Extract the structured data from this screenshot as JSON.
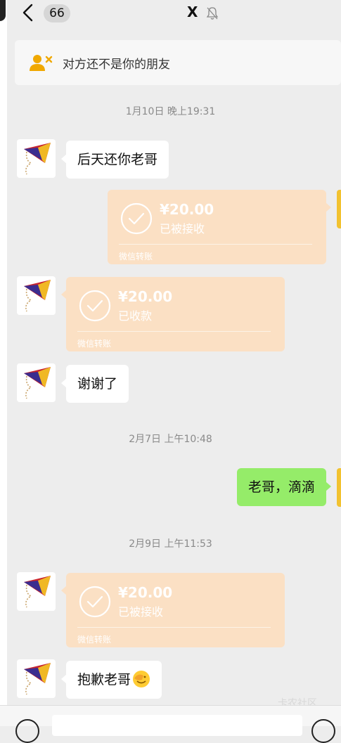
{
  "header": {
    "back_count": "66",
    "title": "X"
  },
  "notice": {
    "text": "对方还不是你的朋友"
  },
  "messages": [
    {
      "kind": "time",
      "text": "1月10日 晚上19:31"
    },
    {
      "kind": "text",
      "side": "left",
      "text": "后天还你老哥"
    },
    {
      "kind": "transfer",
      "side": "right",
      "amount": "¥20.00",
      "status": "已被接收",
      "footer": "微信转账"
    },
    {
      "kind": "transfer",
      "side": "left",
      "amount": "¥20.00",
      "status": "已收款",
      "footer": "微信转账"
    },
    {
      "kind": "text",
      "side": "left",
      "text": "谢谢了"
    },
    {
      "kind": "time",
      "text": "2月7日 上午10:48"
    },
    {
      "kind": "text",
      "side": "right",
      "text": "老哥，滴滴"
    },
    {
      "kind": "time",
      "text": "2月9日 上午11:53"
    },
    {
      "kind": "transfer",
      "side": "left",
      "amount": "¥20.00",
      "status": "已被接收",
      "footer": "微信转账"
    },
    {
      "kind": "text",
      "side": "left",
      "text": "抱歉老哥",
      "emoji": "facepalm-emoji"
    }
  ],
  "watermark": "卡农社区",
  "colors": {
    "bubble_green": "#95ec69",
    "transfer_bg": "#fbe0c4",
    "background": "#ededed"
  }
}
